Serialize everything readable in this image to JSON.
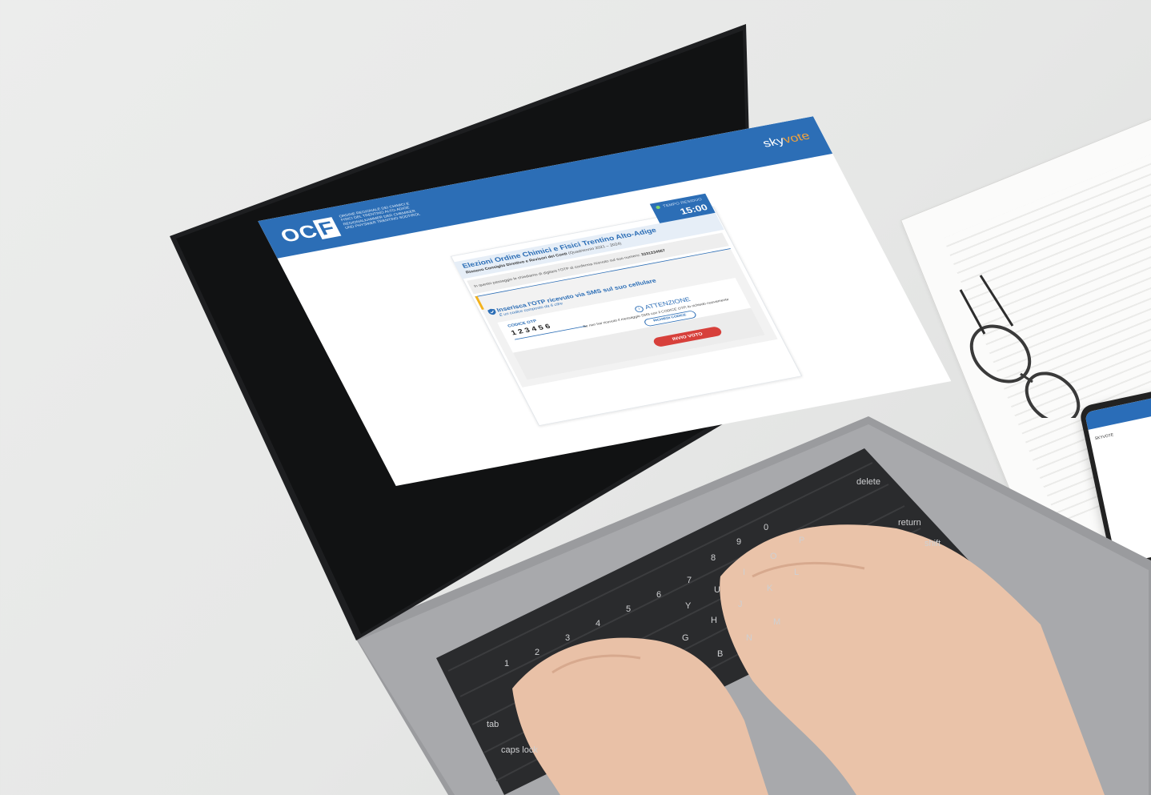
{
  "brand": {
    "name_prefix": "sky",
    "name_suffix": "vote"
  },
  "org": {
    "logo_left": "OC",
    "logo_right": "F",
    "lines": [
      "ORDINE REGIONALE DEI CHIMICI E",
      "FISICI DEL TRENTINO ALTO-ADIGE",
      "REGIONALKAMMER DER CHEMIKER",
      "UND PHYSIKER TRENTINO SÜDTIROL"
    ]
  },
  "timer": {
    "label": "TEMPO RESIDUO",
    "value": "15:00"
  },
  "election": {
    "title": "Elezioni Ordine Chimici e Fisici Trentino Alto-Adige",
    "subtitle_bold": "Rinnovo Consiglio Direttivo e Revisori dei Conti",
    "subtitle_period": "(Quadriennio 2021 – 2024)"
  },
  "note": {
    "text": "In questo passaggio le chiediamo di digitare l'OTP di conferma ricevuto sul suo numero:",
    "number": "3331234567"
  },
  "otp": {
    "heading": "Inserisca l'OTP ricevuto via SMS  sul suo cellulare",
    "subheading": "È un codice composto da 6 cifre",
    "field_label": "CODICE OTP",
    "field_value": "123456"
  },
  "attention": {
    "title": "ATTENZIONE",
    "text": "Se non hai ricevuto il messaggio SMS con il CODICE OTP, lo richiedo nuovamente",
    "button": "RICHIEDI CODICE"
  },
  "submit": {
    "label": "INVIO VOTO"
  },
  "colors": {
    "primary": "#2c6eb6",
    "accent": "#f3a23a",
    "danger": "#d7403b",
    "warning": "#f3b21c"
  },
  "icons": {
    "shield": "shield-check-icon",
    "info": "info-icon",
    "status": "status-dot-icon"
  },
  "keyboard": {
    "keys": [
      "delete",
      "return",
      "shift",
      "tab",
      "caps lock",
      "1",
      "2",
      "3",
      "4",
      "5",
      "6",
      "7",
      "8",
      "9",
      "0",
      "Y",
      "U",
      "I",
      "O",
      "P",
      "G",
      "H",
      "J",
      "K",
      "L",
      "B",
      "N",
      "M"
    ]
  },
  "phone": {
    "screen_text": "SKYVOTE"
  }
}
